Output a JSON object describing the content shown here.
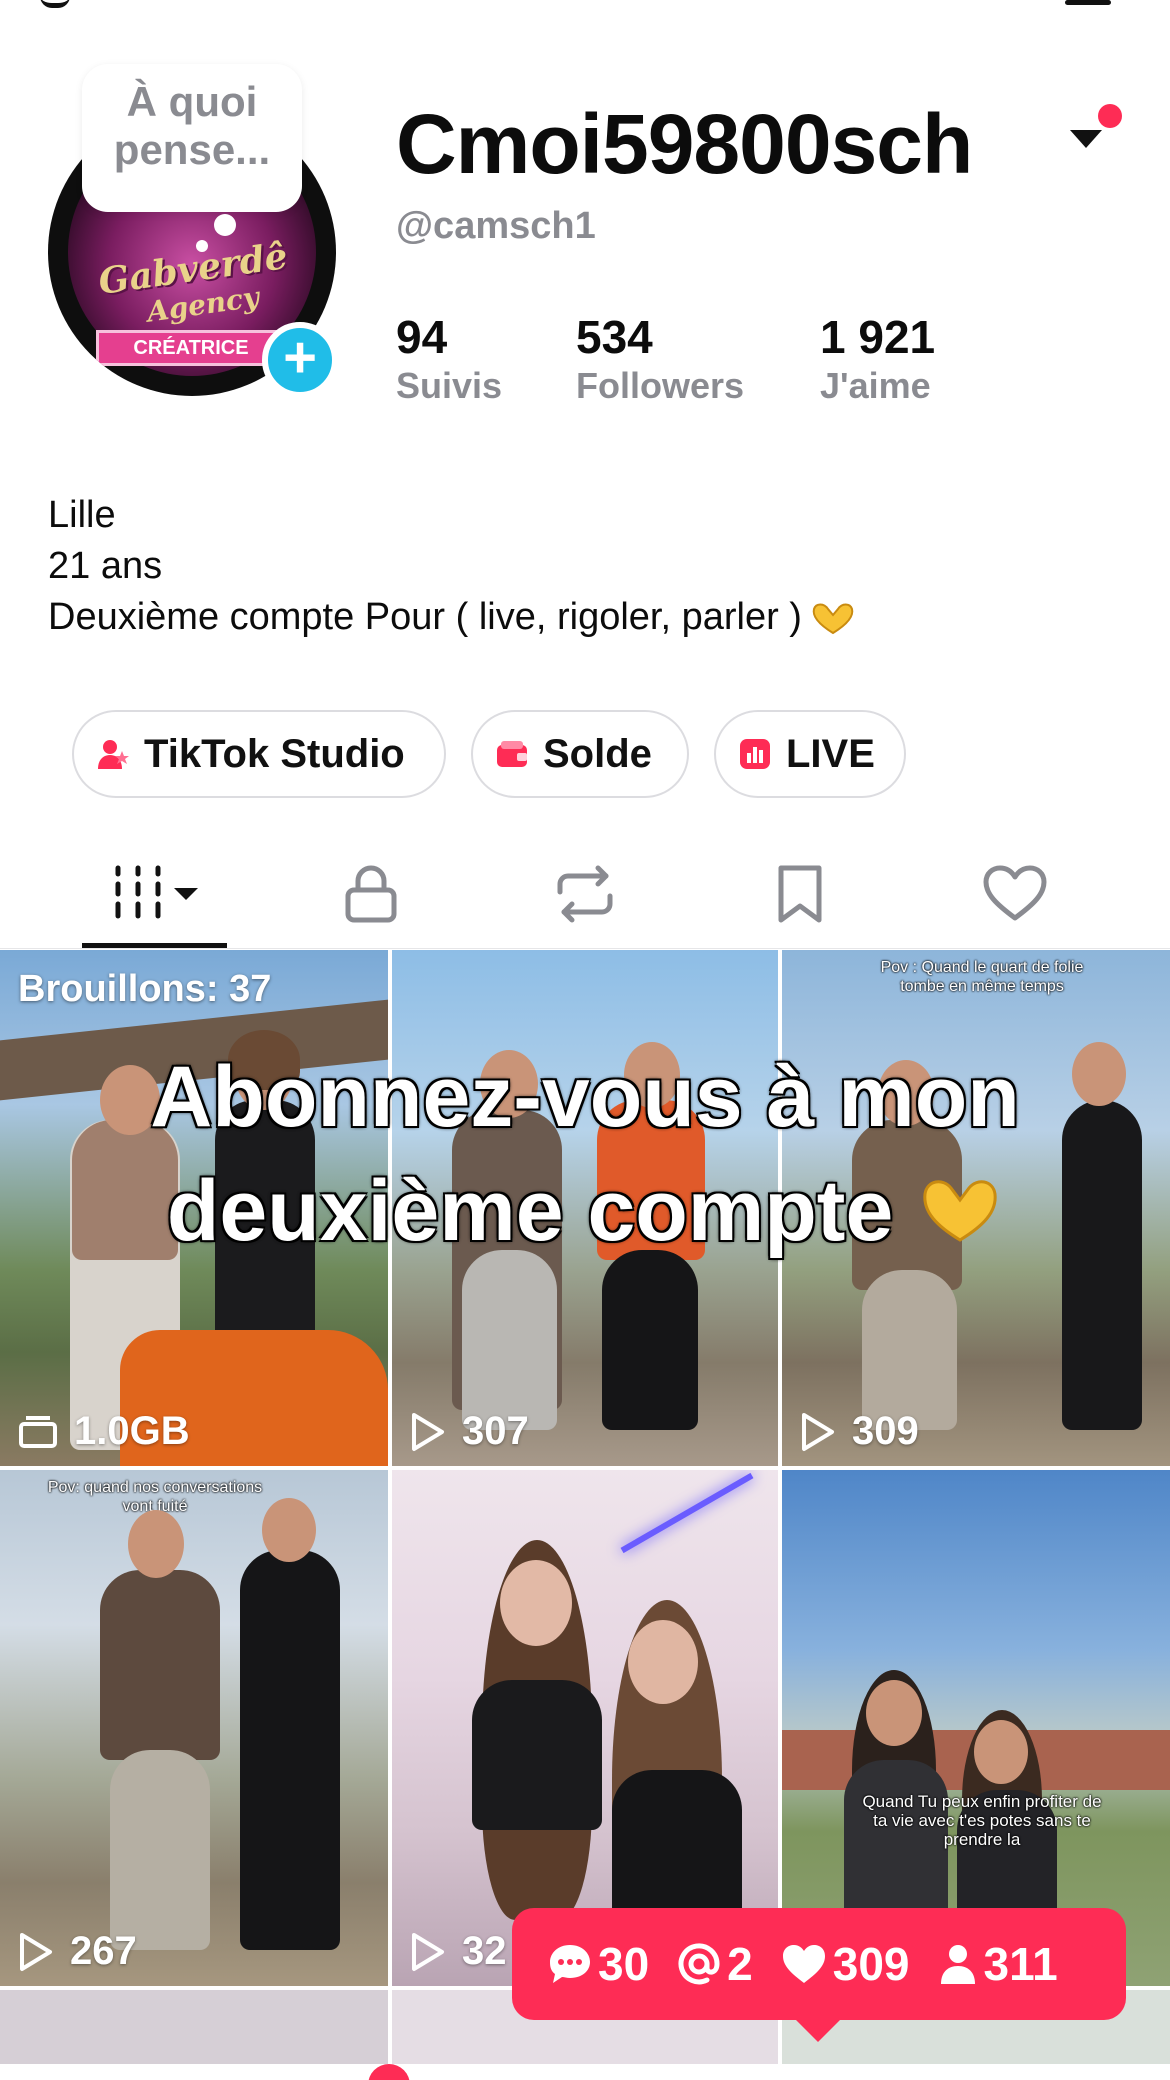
{
  "profile": {
    "thought_bubble": "À quoi pense...",
    "display_name": "Cmoi59800sch",
    "handle": "@camsch1",
    "avatar_badge": "Gabverdê",
    "avatar_badge_sub": "Agency",
    "avatar_ribbon": "CRÉATRICE"
  },
  "stats": [
    {
      "value": "94",
      "label": "Suivis"
    },
    {
      "value": "534",
      "label": "Followers"
    },
    {
      "value": "1 921",
      "label": "J'aime"
    }
  ],
  "bio": {
    "line1": "Lille",
    "line2": "21 ans",
    "line3": "Deuxième compte Pour ( live, rigoler, parler )"
  },
  "actions": {
    "studio": "TikTok Studio",
    "balance": "Solde",
    "live": "LIVE"
  },
  "tabs": [
    "videos-icon",
    "lock-icon",
    "repost-icon",
    "bookmark-icon",
    "heart-icon"
  ],
  "grid": {
    "drafts_label": "Brouillons: 37",
    "overlay_line1": "Abonnez-vous à mon",
    "overlay_line2": "deuxième compte",
    "tiles": [
      {
        "count": "1.0GB",
        "caption": ""
      },
      {
        "count": "307",
        "caption": ""
      },
      {
        "count": "309",
        "caption": "Pov : Quand le quart de folie tombe en même temps"
      },
      {
        "count": "267",
        "caption": "Pov: quand nos conversations vont fuité"
      },
      {
        "count": "32",
        "caption": ""
      },
      {
        "count": "",
        "caption": "Quand Tu peux enfin profiter de ta vie avec t'es potes sans te prendre la"
      }
    ]
  },
  "notifications": {
    "comments": "30",
    "mentions": "2",
    "likes": "309",
    "followers": "311"
  },
  "colors": {
    "accent": "#fe2c55",
    "add_button": "#20bde8",
    "muted_text": "#8a8b91"
  }
}
